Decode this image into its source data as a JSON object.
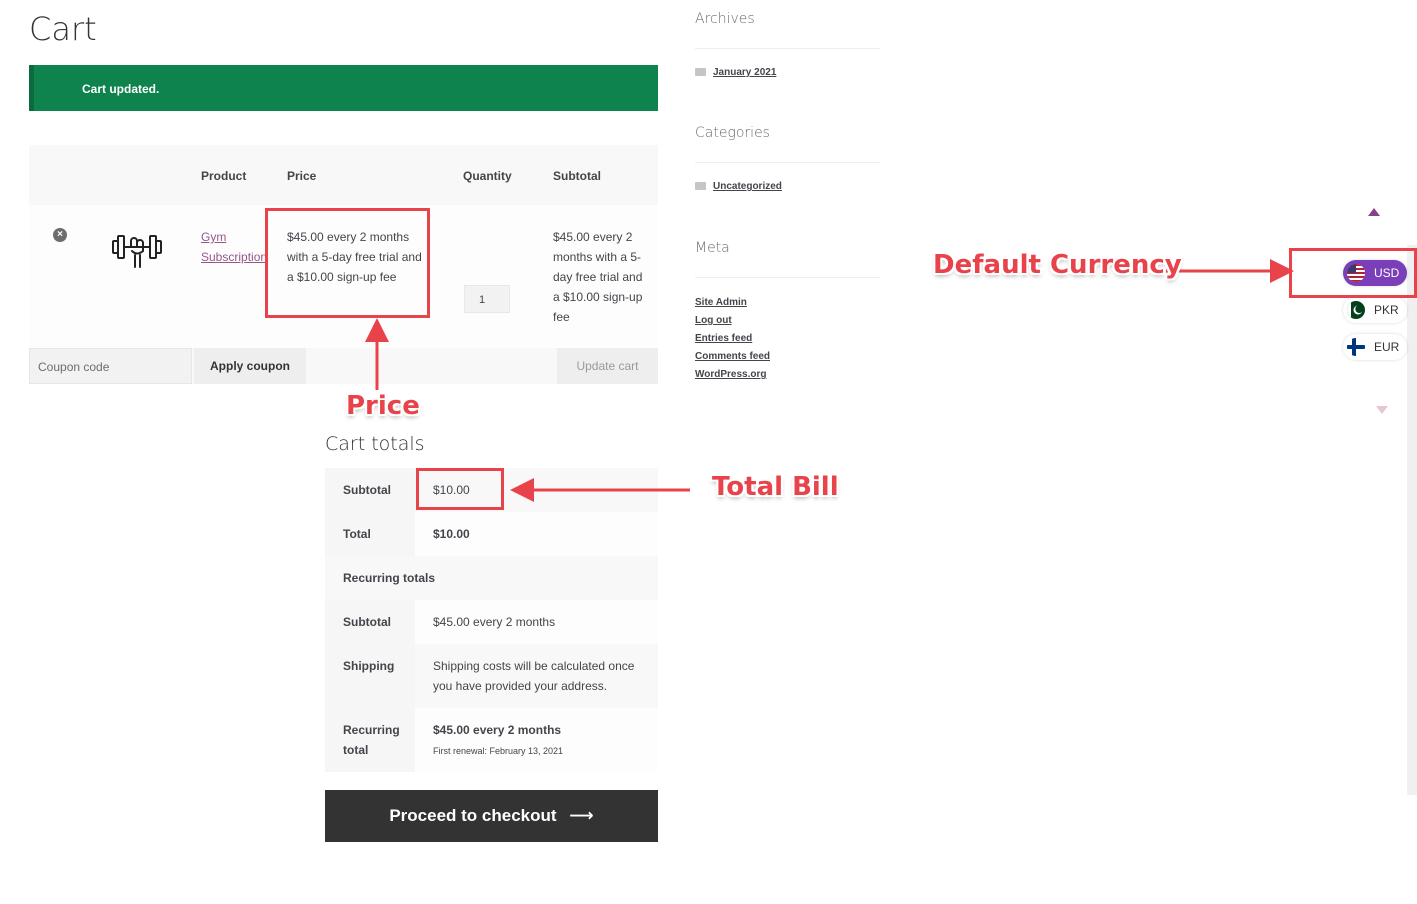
{
  "page": {
    "title": "Cart"
  },
  "notice": {
    "text": "Cart updated."
  },
  "cart": {
    "headers": {
      "product": "Product",
      "price": "Price",
      "quantity": "Quantity",
      "subtotal": "Subtotal"
    },
    "item": {
      "product_name": "Gym Subscription",
      "price": "$45.00 every 2 months with a 5-day free trial and a $10.00 sign-up fee",
      "quantity": "1",
      "subtotal": "$45.00 every 2 months with a 5-day free trial and a $10.00 sign-up fee"
    },
    "coupon_placeholder": "Coupon code",
    "apply_coupon_label": "Apply coupon",
    "update_cart_label": "Update cart"
  },
  "totals": {
    "title": "Cart totals",
    "subtotal_label": "Subtotal",
    "subtotal_value": "$10.00",
    "total_label": "Total",
    "total_value": "$10.00",
    "recurring_heading": "Recurring totals",
    "rec_subtotal_label": "Subtotal",
    "rec_subtotal_value": "$45.00 every 2 months",
    "shipping_label": "Shipping",
    "shipping_value": "Shipping costs will be calculated once you have provided your address.",
    "rec_total_label": "Recurring total",
    "rec_total_value": "$45.00 every 2 months",
    "first_renewal": "First renewal: February 13, 2021"
  },
  "checkout": {
    "label": "Proceed to checkout",
    "arrow": "⟶"
  },
  "sidebar": {
    "archives_title": "Archives",
    "archives_link": "January 2021",
    "categories_title": "Categories",
    "categories_link": "Uncategorized",
    "meta_title": "Meta",
    "meta_links": [
      "Site Admin",
      "Log out",
      "Entries feed",
      "Comments feed",
      "WordPress.org"
    ]
  },
  "currency_switcher": {
    "items": [
      {
        "code": "USD",
        "active": true
      },
      {
        "code": "PKR",
        "active": false
      },
      {
        "code": "EUR",
        "active": false
      }
    ],
    "accent": "#7a3fb8"
  },
  "annotations": {
    "price": "Price",
    "total_bill": "Total Bill",
    "default_currency": "Default Currency",
    "color": "#e8434a"
  }
}
